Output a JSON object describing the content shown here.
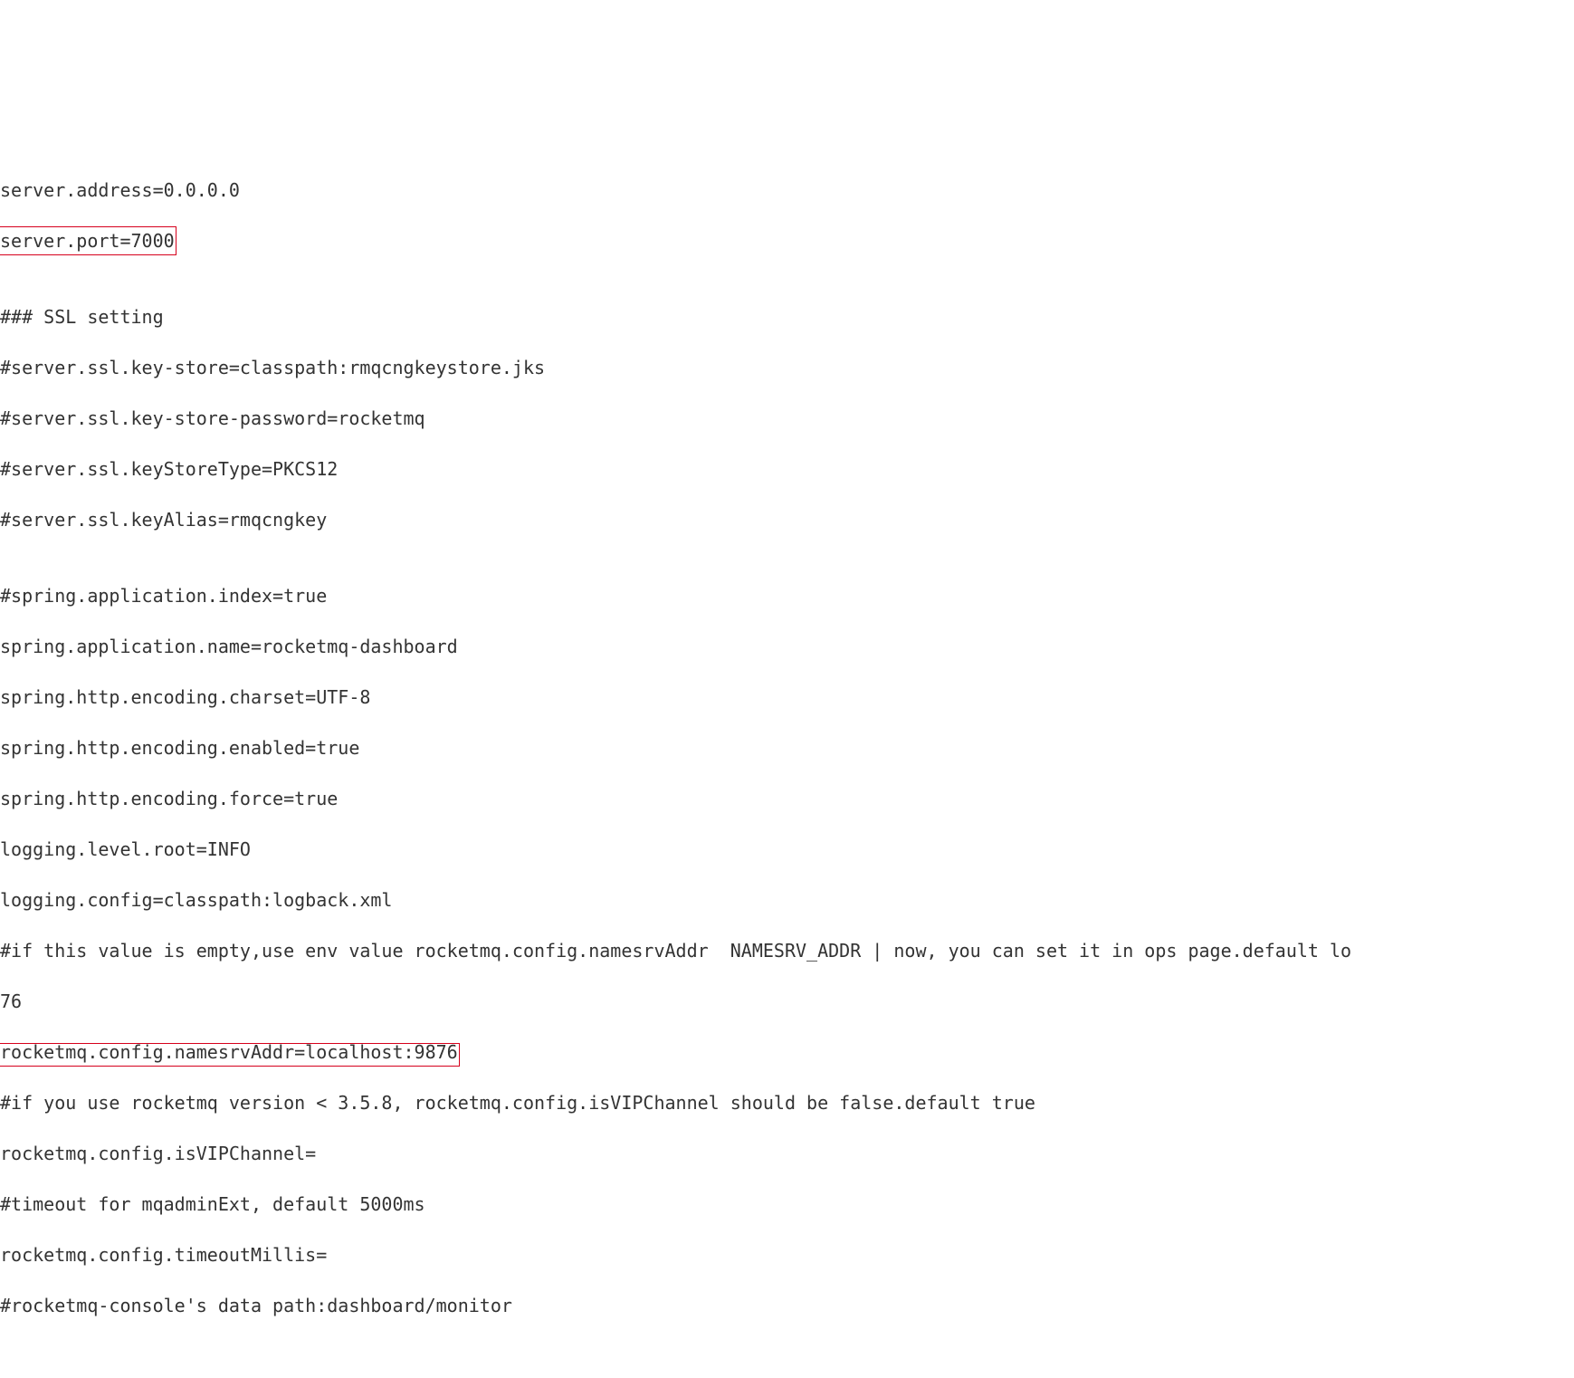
{
  "config": {
    "lines": [
      {
        "text": "server.address=0.0.0.0",
        "highlight": ""
      },
      {
        "text": "server.port=7000",
        "highlight": "port"
      },
      {
        "text": "",
        "highlight": ""
      },
      {
        "text": "### SSL setting",
        "highlight": ""
      },
      {
        "text": "#server.ssl.key-store=classpath:rmqcngkeystore.jks",
        "highlight": ""
      },
      {
        "text": "#server.ssl.key-store-password=rocketmq",
        "highlight": ""
      },
      {
        "text": "#server.ssl.keyStoreType=PKCS12",
        "highlight": ""
      },
      {
        "text": "#server.ssl.keyAlias=rmqcngkey",
        "highlight": ""
      },
      {
        "text": "",
        "highlight": ""
      },
      {
        "text": "#spring.application.index=true",
        "highlight": ""
      },
      {
        "text": "spring.application.name=rocketmq-dashboard",
        "highlight": ""
      },
      {
        "text": "spring.http.encoding.charset=UTF-8",
        "highlight": ""
      },
      {
        "text": "spring.http.encoding.enabled=true",
        "highlight": ""
      },
      {
        "text": "spring.http.encoding.force=true",
        "highlight": ""
      },
      {
        "text": "logging.level.root=INFO",
        "highlight": ""
      },
      {
        "text": "logging.config=classpath:logback.xml",
        "highlight": ""
      },
      {
        "text": "#if this value is empty,use env value rocketmq.config.namesrvAddr  NAMESRV_ADDR | now, you can set it in ops page.default lo",
        "highlight": ""
      },
      {
        "text": "76",
        "highlight": ""
      },
      {
        "text": "rocketmq.config.namesrvAddr=localhost:9876",
        "highlight": "namesrv"
      },
      {
        "text": "#if you use rocketmq version < 3.5.8, rocketmq.config.isVIPChannel should be false.default true",
        "highlight": ""
      },
      {
        "text": "rocketmq.config.isVIPChannel=",
        "highlight": ""
      },
      {
        "text": "#timeout for mqadminExt, default 5000ms",
        "highlight": ""
      },
      {
        "text": "rocketmq.config.timeoutMillis=",
        "highlight": ""
      },
      {
        "text": "#rocketmq-console's data path:dashboard/monitor",
        "highlight": ""
      }
    ]
  }
}
